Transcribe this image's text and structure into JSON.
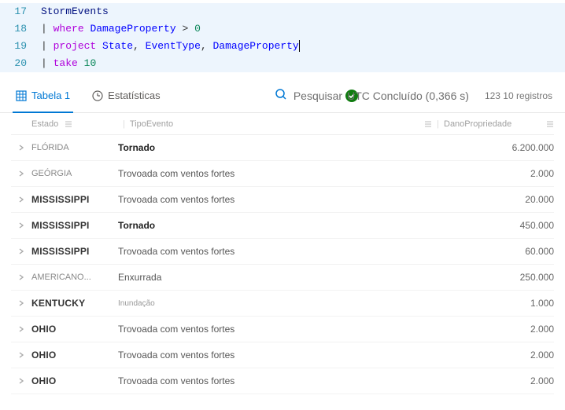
{
  "editor": {
    "lines": [
      {
        "no": "17",
        "tokens": [
          {
            "cls": "tok-id",
            "t": "StormEvents"
          }
        ]
      },
      {
        "no": "18",
        "tokens": [
          {
            "cls": "tok-com",
            "t": "| "
          },
          {
            "cls": "tok-kw",
            "t": "where"
          },
          {
            "cls": "tok-com",
            "t": " "
          },
          {
            "cls": "tok-fld",
            "t": "DamageProperty"
          },
          {
            "cls": "tok-com",
            "t": " > "
          },
          {
            "cls": "tok-num",
            "t": "0"
          }
        ]
      },
      {
        "no": "19",
        "tokens": [
          {
            "cls": "tok-com",
            "t": "| "
          },
          {
            "cls": "tok-kw",
            "t": "project"
          },
          {
            "cls": "tok-com",
            "t": " "
          },
          {
            "cls": "tok-fld",
            "t": "State"
          },
          {
            "cls": "tok-com",
            "t": ", "
          },
          {
            "cls": "tok-fld",
            "t": "EventType"
          },
          {
            "cls": "tok-com",
            "t": ", "
          },
          {
            "cls": "tok-fld",
            "t": "DamageProperty"
          }
        ]
      },
      {
        "no": "20",
        "tokens": [
          {
            "cls": "tok-com",
            "t": "| "
          },
          {
            "cls": "tok-kw",
            "t": "take"
          },
          {
            "cls": "tok-com",
            "t": " "
          },
          {
            "cls": "tok-num",
            "t": "10"
          }
        ]
      }
    ],
    "cursor_line": "19"
  },
  "tabs": {
    "table": "Tabela 1",
    "stats": "Estatísticas"
  },
  "search": {
    "label": "Pesquisar"
  },
  "timing": {
    "label": "UTC Concluído (0,366 s)"
  },
  "records": {
    "label": "123 10 registros"
  },
  "headers": {
    "state": "Estado",
    "event": "TipoEvento",
    "damage": "DanoPropriedade"
  },
  "rows": [
    {
      "state": "FLÓRIDA",
      "state_style": "light",
      "event": "Tornado",
      "event_style": "strong",
      "dmg": "6.200.000"
    },
    {
      "state": "GEÓRGIA",
      "state_style": "light",
      "event": "Trovoada com ventos fortes",
      "event_style": "normal",
      "dmg": "2.000"
    },
    {
      "state": "MISSISSIPPI",
      "state_style": "strong",
      "event": "Trovoada com ventos fortes",
      "event_style": "normal",
      "dmg": "20.000"
    },
    {
      "state": "MISSISSIPPI",
      "state_style": "strong",
      "event": "Tornado",
      "event_style": "strong",
      "dmg": "450.000"
    },
    {
      "state": "MISSISSIPPI",
      "state_style": "strong",
      "event": "Trovoada com ventos fortes",
      "event_style": "normal",
      "dmg": "60.000"
    },
    {
      "state": "AMERICANO...",
      "state_style": "light",
      "event": "Enxurrada",
      "event_style": "normal",
      "dmg": "250.000"
    },
    {
      "state": "KENTUCKY",
      "state_style": "strong",
      "event": "Inundação",
      "event_style": "small",
      "dmg": "1.000"
    },
    {
      "state": "OHIO",
      "state_style": "strong",
      "event": "Trovoada com ventos fortes",
      "event_style": "normal",
      "dmg": "2.000"
    },
    {
      "state": "OHIO",
      "state_style": "strong",
      "event": "Trovoada com ventos fortes",
      "event_style": "normal",
      "dmg": "2.000"
    },
    {
      "state": "OHIO",
      "state_style": "strong",
      "event": "Trovoada com ventos fortes",
      "event_style": "normal",
      "dmg": "2.000"
    }
  ]
}
